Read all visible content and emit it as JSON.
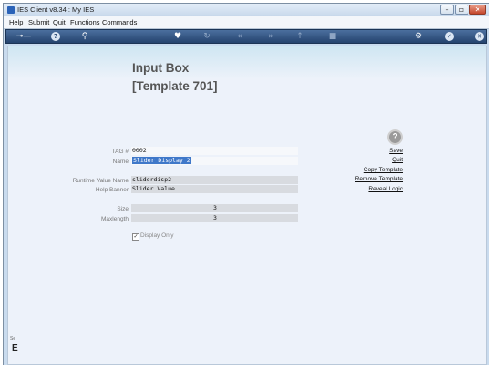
{
  "window": {
    "title": "IES Client v8.34 : My IES"
  },
  "menu": [
    "Help",
    "Submit",
    "Quit",
    "Functions",
    "Commands"
  ],
  "toolbar": {
    "icons": [
      "key-icon",
      "help-icon",
      "search-icon",
      "heart-icon",
      "refresh-icon",
      "rewind-icon",
      "fast-forward-icon",
      "upload-icon",
      "stop-icon",
      "settings-icon",
      "check-icon",
      "close-icon"
    ]
  },
  "page": {
    "title": "Input Box",
    "subtitle": "[Template 701]"
  },
  "form": {
    "tag_label": "TAG #",
    "tag_value": "0002",
    "name_label": "Name",
    "name_value": "Slider Display 2",
    "runtime_label": "Runtime Value Name",
    "runtime_value": "sliderdisp2",
    "banner_label": "Help Banner",
    "banner_value": "Slider Value",
    "size_label": "Size",
    "size_value": "3",
    "maxlength_label": "Maxlength",
    "maxlength_value": "3",
    "display_only_label": "Display Only",
    "display_only_checked": true
  },
  "actions": {
    "save": "Save",
    "quit": "Quit",
    "copy": "Copy Template",
    "remove": "Remove Template",
    "reveal": "Reveal Logic"
  },
  "sidebar_stub": {
    "small": "Se",
    "big": "E"
  }
}
